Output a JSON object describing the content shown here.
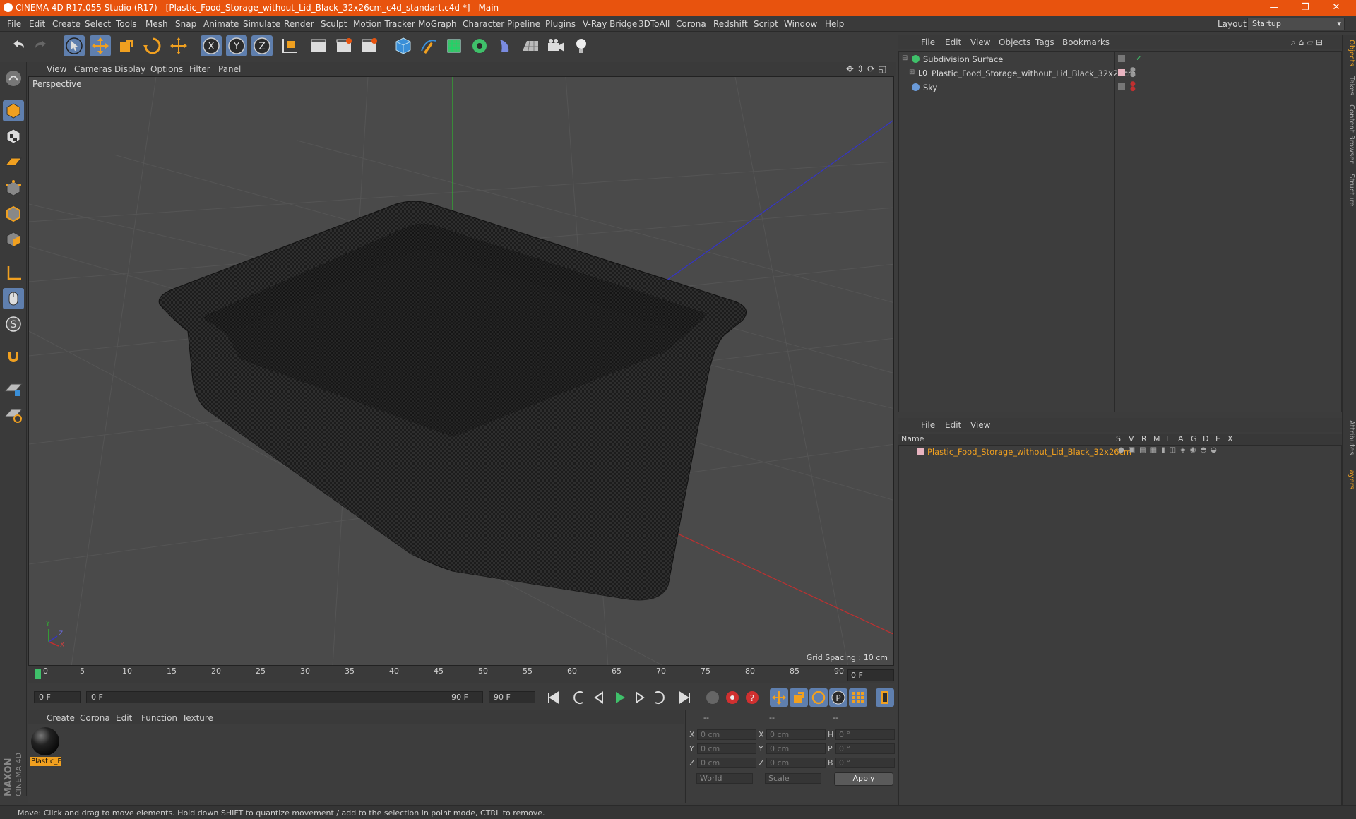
{
  "window": {
    "title": "CINEMA 4D R17.055 Studio (R17) - [Plastic_Food_Storage_without_Lid_Black_32x26cm_c4d_standart.c4d *] - Main",
    "controls": {
      "minimize": "—",
      "restore": "❐",
      "close": "✕"
    }
  },
  "menubar": {
    "items": [
      "File",
      "Edit",
      "Create",
      "Select",
      "Tools",
      "Mesh",
      "Snap",
      "Animate",
      "Simulate",
      "Render",
      "Sculpt",
      "Motion Tracker",
      "MoGraph",
      "Character",
      "Pipeline",
      "Plugins",
      "V-Ray Bridge",
      "3DToAll",
      "Corona",
      "Redshift",
      "Script",
      "Window",
      "Help"
    ],
    "layout_label": "Layout:",
    "layout_value": "Startup"
  },
  "viewport": {
    "menu": [
      "View",
      "Cameras",
      "Display",
      "Options",
      "Filter",
      "Panel"
    ],
    "label": "Perspective",
    "grid_spacing": "Grid Spacing : 10 cm",
    "axis_labels": {
      "y": "Y",
      "z": "Z",
      "x": "X"
    }
  },
  "timeline": {
    "ticks": [
      "0",
      "5",
      "10",
      "15",
      "20",
      "25",
      "30",
      "35",
      "40",
      "45",
      "50",
      "55",
      "60",
      "65",
      "70",
      "75",
      "80",
      "85",
      "90"
    ],
    "current_frame": "0 F",
    "start_field": "0 F",
    "range_start": "0 F",
    "range_end": "90 F",
    "end_field": "90 F"
  },
  "materials": {
    "menu": [
      "Create",
      "Corona",
      "Edit",
      "Function",
      "Texture"
    ],
    "items": [
      {
        "label": "Plastic_F"
      }
    ]
  },
  "coordinates": {
    "headers": [
      "--",
      "--",
      "--"
    ],
    "rows": [
      {
        "axis": "X",
        "pos": "0 cm",
        "axis2": "X",
        "size": "0 cm",
        "rot_label": "H",
        "rot": "0 °"
      },
      {
        "axis": "Y",
        "pos": "0 cm",
        "axis2": "Y",
        "size": "0 cm",
        "rot_label": "P",
        "rot": "0 °"
      },
      {
        "axis": "Z",
        "pos": "0 cm",
        "axis2": "Z",
        "size": "0 cm",
        "rot_label": "B",
        "rot": "0 °"
      }
    ],
    "mode_select": "World",
    "scale_select": "Scale",
    "apply_label": "Apply"
  },
  "objects": {
    "menu": [
      "File",
      "Edit",
      "View",
      "Objects",
      "Tags",
      "Bookmarks"
    ],
    "items": [
      {
        "name": "Subdivision Surface"
      },
      {
        "name": "Plastic_Food_Storage_without_Lid_Black_32x26cm"
      },
      {
        "name": "Sky"
      }
    ]
  },
  "layers": {
    "menu": [
      "File",
      "Edit",
      "View"
    ],
    "name_header": "Name",
    "flag_headers": [
      "S",
      "V",
      "R",
      "M",
      "L",
      "A",
      "G",
      "D",
      "E",
      "X"
    ],
    "items": [
      {
        "name": "Plastic_Food_Storage_without_Lid_Black_32x26cm"
      }
    ]
  },
  "side_tabs": [
    "Objects",
    "Takes",
    "Content Browser",
    "Structure",
    "Attributes",
    "Layers"
  ],
  "status": "Move: Click and drag to move elements. Hold down SHIFT to quantize movement / add to the selection in point mode, CTRL to remove.",
  "brand": "MAXON CINEMA 4D",
  "colors": {
    "accent": "#e8530e",
    "selected_text": "#f0a030",
    "green_axis": "#2fb52f",
    "blue_axis": "#3434c8",
    "red_axis": "#c03030"
  }
}
